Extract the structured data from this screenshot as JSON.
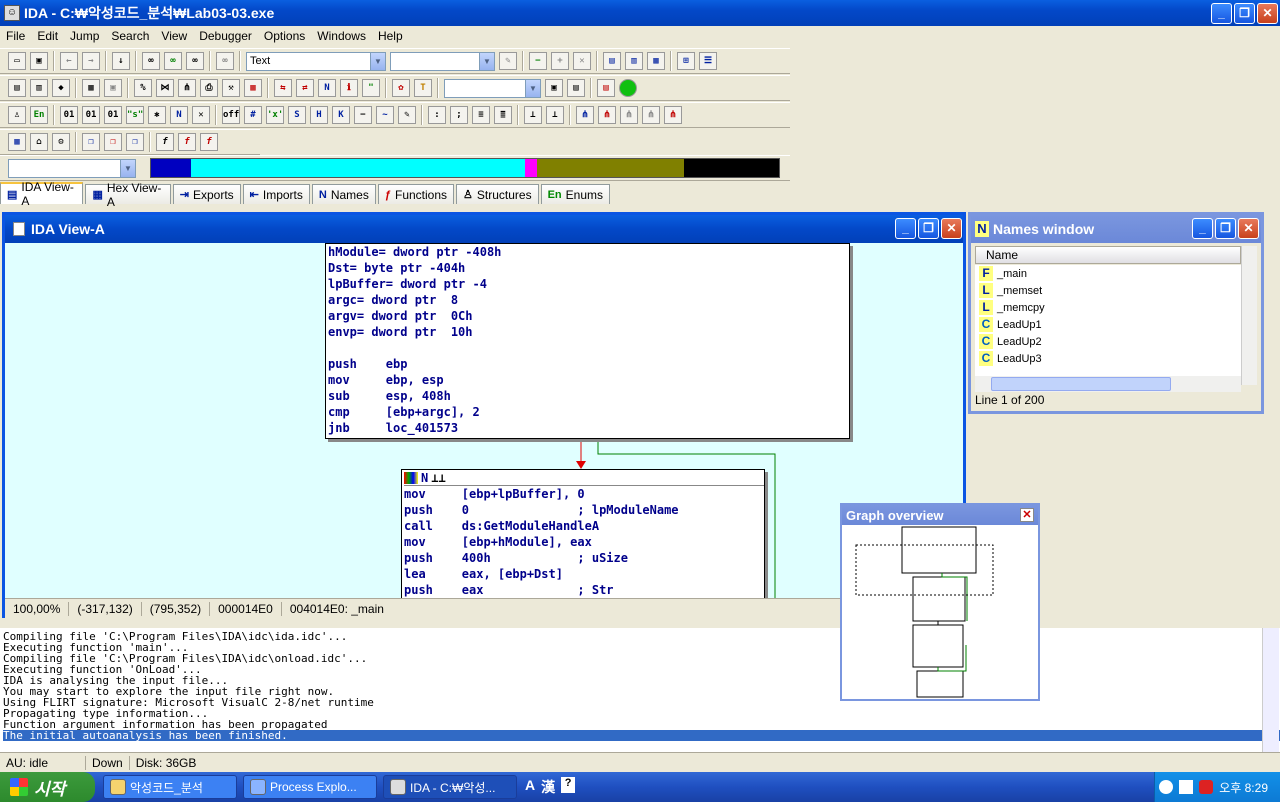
{
  "window": {
    "title": "IDA - C:₩악성코드_분석₩Lab03-03.exe"
  },
  "menu": [
    "File",
    "Edit",
    "Jump",
    "Search",
    "View",
    "Debugger",
    "Options",
    "Windows",
    "Help"
  ],
  "toolbar": {
    "text_combo": "Text"
  },
  "tabs": [
    {
      "label": "IDA View-A",
      "icon": "document-icon"
    },
    {
      "label": "Hex View-A",
      "icon": "hex-icon"
    },
    {
      "label": "Exports",
      "icon": "exports-icon"
    },
    {
      "label": "Imports",
      "icon": "imports-icon"
    },
    {
      "label": "Names",
      "icon": "names-icon"
    },
    {
      "label": "Functions",
      "icon": "functions-icon"
    },
    {
      "label": "Structures",
      "icon": "structures-icon"
    },
    {
      "label": "Enums",
      "icon": "enums-icon"
    }
  ],
  "ida_view": {
    "title": "IDA View-A",
    "node1": [
      "hModule= dword ptr -408h",
      "Dst= byte ptr -404h",
      "lpBuffer= dword ptr -4",
      "argc= dword ptr  8",
      "argv= dword ptr  0Ch",
      "envp= dword ptr  10h",
      "",
      "push    ebp",
      "mov     ebp, esp",
      "sub     esp, 408h",
      "cmp     [ebp+argc], 2",
      "jnb     loc_401573"
    ],
    "node2": [
      "mov     [ebp+lpBuffer], 0",
      "push    0               ; lpModuleName",
      "call    ds:GetModuleHandleA",
      "mov     [ebp+hModule], eax",
      "push    400h            ; uSize",
      "lea     eax, [ebp+Dst]",
      "push    eax             ; Str"
    ],
    "status": {
      "zoom": "100,00%",
      "coord1": "(-317,132)",
      "coord2": "(795,352)",
      "offset": "000014E0",
      "address": "004014E0: _main"
    }
  },
  "names_window": {
    "title": "Names window",
    "column": "Name",
    "items": [
      {
        "type": "F",
        "name": "_main"
      },
      {
        "type": "L",
        "name": "_memset"
      },
      {
        "type": "L",
        "name": "_memcpy"
      },
      {
        "type": "C",
        "name": "LeadUp1"
      },
      {
        "type": "C",
        "name": "LeadUp2"
      },
      {
        "type": "C",
        "name": "LeadUp3"
      }
    ],
    "footer": "Line 1 of 200"
  },
  "graph_overview": {
    "title": "Graph overview"
  },
  "output": [
    "Compiling file 'C:\\Program Files\\IDA\\idc\\ida.idc'...",
    "Executing function 'main'...",
    "Compiling file 'C:\\Program Files\\IDA\\idc\\onload.idc'...",
    "Executing function 'OnLoad'...",
    "IDA is analysing the input file...",
    "You may start to explore the input file right now.",
    "Using FLIRT signature: Microsoft VisualC 2-8/net runtime",
    "Propagating type information...",
    "Function argument information has been propagated",
    "The initial autoanalysis has been finished."
  ],
  "status_bar": {
    "au": "AU:  idle",
    "down": "Down",
    "disk": "Disk: 36GB"
  },
  "taskbar": {
    "start": "시작",
    "tasks": [
      "악성코드_분석",
      "Process Explo...",
      "IDA - C:₩악성..."
    ],
    "clock": "오후 8:29"
  }
}
